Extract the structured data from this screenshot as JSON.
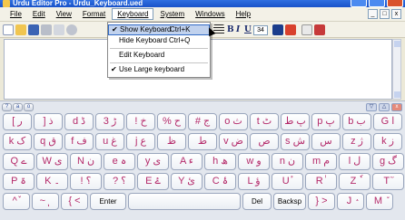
{
  "window": {
    "title": "Urdu Editor Pro - Urdu_Keyboard.ued"
  },
  "menu": {
    "items": [
      "File",
      "Edit",
      "View",
      "Format",
      "Keyboard",
      "System",
      "Windows",
      "Help"
    ],
    "mdi_controls": [
      "_",
      "□",
      "x"
    ]
  },
  "toolbar": {
    "font_size": "34",
    "format_buttons": [
      "B",
      "I",
      "U"
    ]
  },
  "keyboard_menu": {
    "items": [
      {
        "label": "Show Keyboard",
        "shortcut": "Ctrl+K",
        "checked": true
      },
      {
        "label": "Hide Keyboard",
        "shortcut": "Ctrl+Q",
        "checked": false
      },
      {
        "label": "Edit Keyboard",
        "shortcut": "",
        "checked": false
      },
      {
        "label": "Use Large keyboard",
        "shortcut": "",
        "checked": true
      }
    ]
  },
  "onscreen_keyboard": {
    "tabs": [
      "?",
      "a",
      "o"
    ],
    "controls": [
      "▽",
      "△",
      "x"
    ],
    "rows": [
      [
        "[ ر",
        "] ذ",
        "d ڈ",
        "3 ڑ",
        "! خ",
        "% ح",
        "# ج",
        "o ث",
        "t ٹ",
        "پ ط",
        "p پ",
        "b ب",
        "G ا"
      ],
      [
        "k ک",
        "q ق",
        "f ف",
        "u غ",
        "j ع",
        "ظ",
        "ط",
        "v ض",
        "ص",
        "s ش",
        "س",
        "z ژ",
        "k ز"
      ],
      [
        "Q ے",
        "W ی",
        "N ن",
        "e ہ",
        "y ی",
        "A ء",
        "h ھ",
        "w و",
        "n ن",
        "m م",
        "l ل",
        "g گ"
      ],
      [
        "P ۃ",
        "K ۔",
        "! ؟",
        "? ؟",
        "E ۓ",
        "Y ئ",
        "C ۂ",
        "L ؤ",
        "U ٔ",
        "R ٰ",
        "Z ٗ",
        "T ٓ"
      ],
      [
        "^ ٚ",
        "~ ٖ",
        "{ <",
        "Enter",
        "space",
        "Del",
        "Backsp",
        "} >",
        "J ٛ",
        "M ٘"
      ]
    ]
  }
}
